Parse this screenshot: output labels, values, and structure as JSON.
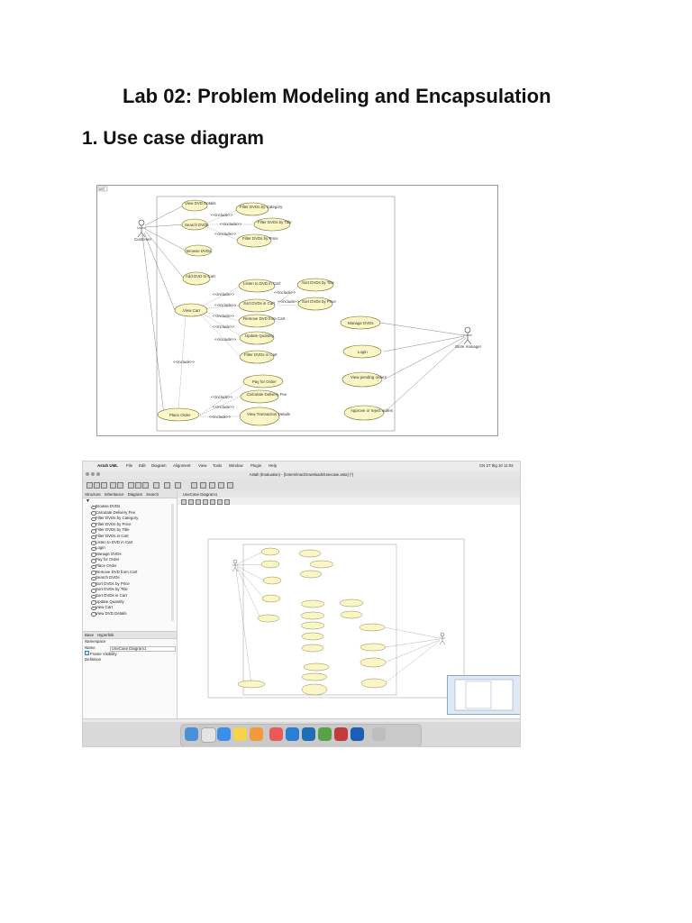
{
  "document": {
    "title": "Lab 02: Problem Modeling and Encapsulation",
    "section_heading": "1. Use case diagram"
  },
  "diagram": {
    "frame_label": "ucl",
    "actors": [
      "Customer",
      "Store manager"
    ],
    "use_cases": [
      "View DVD Details",
      "Search DVDs",
      "Browse DVDs",
      "Add DVD to Cart",
      "View Cart",
      "Place Order",
      "Filter DVDs by Category",
      "Filter DVDs by Title",
      "Filter DVDs by Price",
      "Listen to DVD in Cart",
      "Sort DVDs in Cart",
      "Remove DVD from Cart",
      "Update Quantity",
      "Filter DVDs in Cart",
      "Sort DVDs by Title",
      "Sort DVDs by Price",
      "Pay for Order",
      "Calculate Delivery Fee",
      "View Transaction Details",
      "Manage DVDs",
      "Login",
      "View pending orders",
      "Approve or reject orders"
    ],
    "relation_label": "<<include>>"
  },
  "app": {
    "menu": {
      "apple": "",
      "items": [
        "Astah UML",
        "File",
        "Edit",
        "Diagram",
        "Alignment",
        "View",
        "Tools",
        "Window",
        "Plugin",
        "Help"
      ],
      "clock": "CN 27 thg 10 11:02"
    },
    "window_title": "Astah (Evaluation) - [/Users/mac/Downloads/Usecase.asta] (*)",
    "left_tabs": [
      "Structure",
      "Inheritance",
      "Diagram",
      "Search"
    ],
    "tree_items": [
      "Browse DVDs",
      "Calculate Delivery Fee",
      "Filter DVDs by Category",
      "Filter DVDs by Price",
      "Filter DVDs by Title",
      "Filter DVDs in Cart",
      "Listen to DVD in Cart",
      "Login",
      "Manage DVDs",
      "Pay for Order",
      "Place Order",
      "Remove DVD from Cart",
      "Search DVDs",
      "Sort DVDs by Price",
      "Sort DVDs by Title",
      "Sort DVDs in Cart",
      "Update Quantity",
      "View Cart",
      "View DVD Details"
    ],
    "prop_tabs": [
      "Base",
      "Hyperlink"
    ],
    "props": {
      "namespace_label": "Namespace",
      "name_label": "Name",
      "name_value": "UseCase Diagram1",
      "frame_visibility": "Frame Visibility",
      "definition_label": "Definition"
    },
    "diagram_tab": "UseCase Diagram1"
  },
  "colors": {
    "usecase_fill": "#fbf6c6",
    "usecase_stroke": "#6b6b2a"
  }
}
